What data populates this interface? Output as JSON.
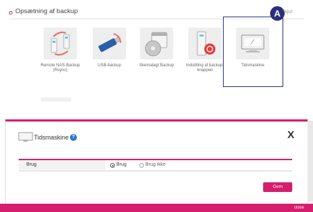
{
  "section": {
    "title": "Opsætning af backup",
    "hide_link": "Skjul"
  },
  "tiles": [
    {
      "label": "Remote NAS-Backup (Rsync)",
      "icon": "remote-nas-backup-icon"
    },
    {
      "label": "USB-backup",
      "icon": "usb-backup-icon"
    },
    {
      "label": "Skemalagt Backup",
      "icon": "scheduled-backup-icon"
    },
    {
      "label": "Indstilling af backup-knappen",
      "icon": "backup-button-icon"
    },
    {
      "label": "Tidsmaskine",
      "icon": "time-machine-icon"
    }
  ],
  "marker": {
    "label": "A",
    "color": "#2d2f7e"
  },
  "dialog": {
    "title": "Tidsmaskine",
    "close_label": "X",
    "row_label": "Brug",
    "options": [
      "Brug",
      "Brug ikke"
    ],
    "selected": "Brug",
    "save_label": "Gem",
    "corner_label": "close"
  },
  "colors": {
    "accent": "#d51f6e",
    "marker": "#2d2f7e",
    "help": "#1f7bd0"
  }
}
